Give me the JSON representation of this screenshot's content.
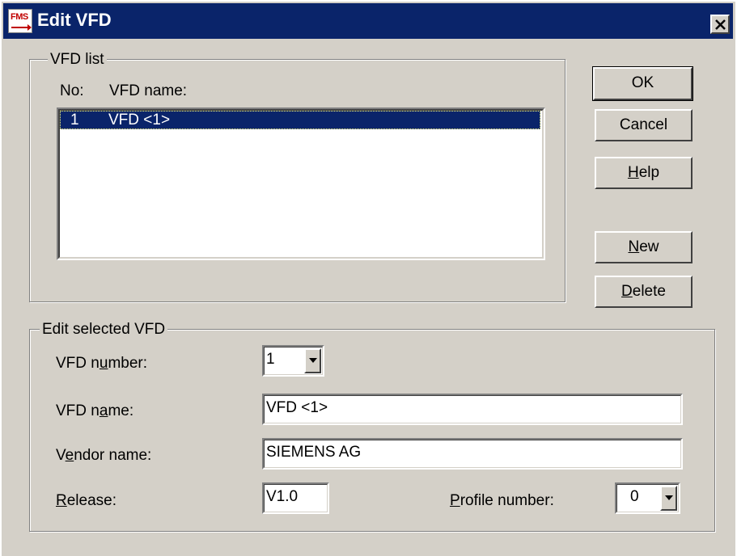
{
  "window": {
    "title": "Edit VFD",
    "app_icon_text": "FMS"
  },
  "vfd_list": {
    "group_title": "VFD list",
    "col_no": "No:",
    "col_name": "VFD name:",
    "rows": [
      {
        "no": "1",
        "name": "VFD <1>",
        "selected": true
      }
    ]
  },
  "buttons": {
    "ok": "OK",
    "cancel": "Cancel",
    "help": {
      "pre": "",
      "key": "H",
      "post": "elp"
    },
    "new": {
      "pre": "",
      "key": "N",
      "post": "ew"
    },
    "delete": {
      "pre": "",
      "key": "D",
      "post": "elete"
    }
  },
  "edit": {
    "group_title": "Edit selected VFD",
    "vfd_number": {
      "pre": "VFD n",
      "key": "u",
      "post": "mber:",
      "value": "1"
    },
    "vfd_name": {
      "pre": "VFD n",
      "key": "a",
      "post": "me:",
      "value": "VFD <1>"
    },
    "vendor_name": {
      "pre": "V",
      "key": "e",
      "post": "ndor name:",
      "value": "SIEMENS AG"
    },
    "release": {
      "pre": "",
      "key": "R",
      "post": "elease:",
      "value": "V1.0"
    },
    "profile_number": {
      "pre": "",
      "key": "P",
      "post": "rofile number:",
      "value": "0"
    }
  },
  "colors": {
    "title_bar": "#0a246a",
    "face": "#d4d0c8",
    "selection": "#0a246a"
  },
  "icons": {
    "close": "close-x-icon",
    "app": "fms-app-icon",
    "dropdown": "chevron-down-icon"
  }
}
